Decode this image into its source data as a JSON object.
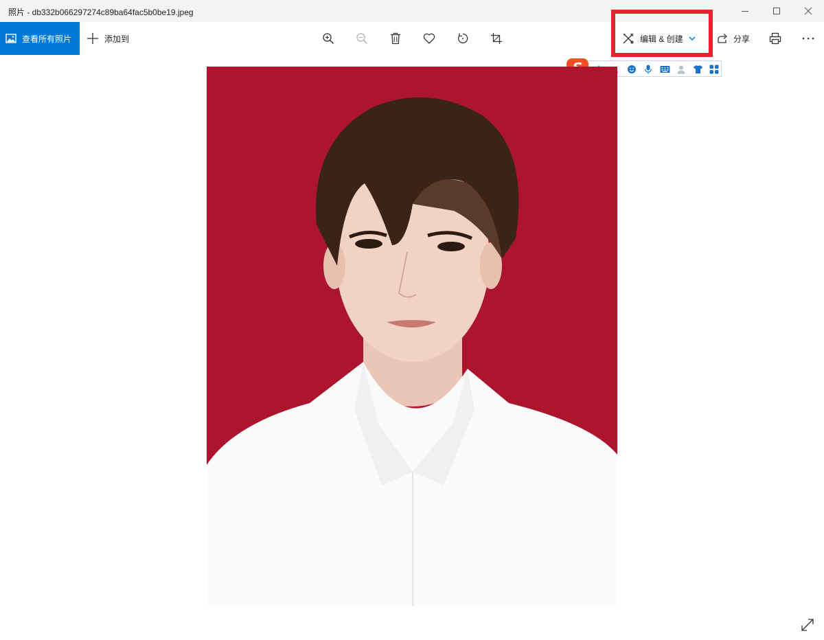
{
  "window": {
    "title": "照片 - db332b066297274c89ba64fac5b0be19.jpeg"
  },
  "toolbar": {
    "all_photos_label": "查看所有照片",
    "add_to_label": "添加到",
    "edit_create_label": "编辑 & 创建",
    "share_label": "分享",
    "icons": [
      "zoom-in-icon",
      "zoom-out-icon",
      "trash-icon",
      "heart-icon",
      "rotate-icon",
      "crop-icon",
      "print-icon",
      "more-icon"
    ]
  },
  "ime_bar": {
    "logo": "S",
    "mode": "中",
    "punct": "°,"
  },
  "colors": {
    "accent": "#0078d7",
    "highlight": "#e8232b",
    "photo_background": "#b3162f",
    "ime_blue": "#1a73c8"
  }
}
